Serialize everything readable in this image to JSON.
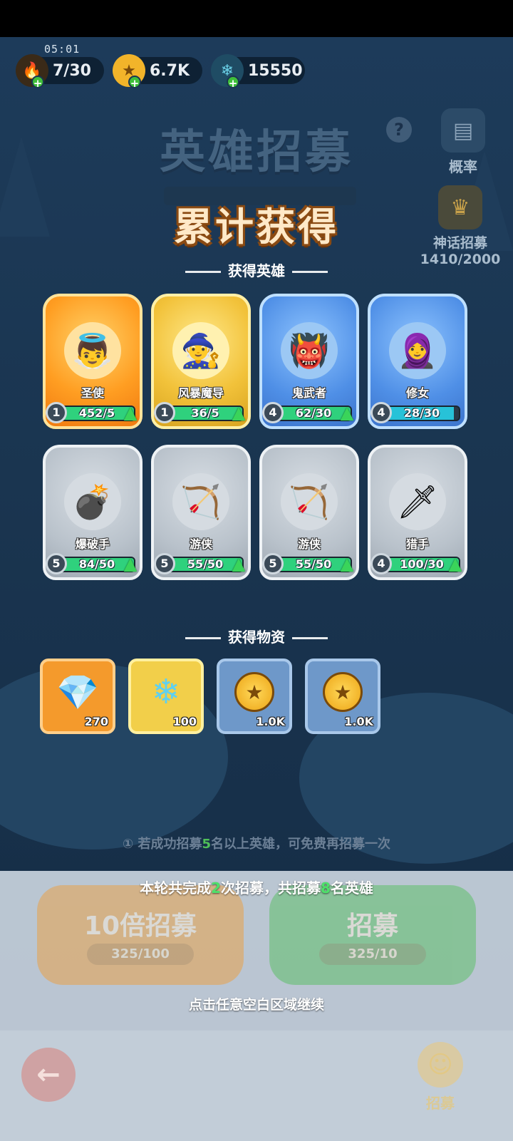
{
  "status": {
    "time": "05:01"
  },
  "resources": [
    {
      "name": "stamina",
      "value": "7/30",
      "icon": "flame-icon",
      "glyph": "🔥",
      "color": "#f39a2a"
    },
    {
      "name": "gold",
      "value": "6.7K",
      "icon": "coin-icon",
      "glyph": "★",
      "color": "#f2b42a"
    },
    {
      "name": "crystal",
      "value": "15550",
      "icon": "snowflake-icon",
      "glyph": "❄",
      "color": "#6ad0e6"
    }
  ],
  "header": {
    "bg_title": "英雄招募",
    "main_title": "累计获得",
    "help_glyph": "?"
  },
  "side": {
    "probability": {
      "label": "概率",
      "glyph": "▤"
    },
    "mythic": {
      "label": "神话招募",
      "progress": "1410/2000",
      "glyph": "♛"
    }
  },
  "heroes_section": {
    "title": "获得英雄"
  },
  "heroes": [
    {
      "name": "圣使",
      "level": "1",
      "count": "452/5",
      "fill": 1.0,
      "rarity": "orange",
      "glyph": "👼",
      "bg": "#ffe2a0",
      "up": true
    },
    {
      "name": "风暴魔导",
      "level": "1",
      "count": "36/5",
      "fill": 1.0,
      "rarity": "gold",
      "glyph": "🧙",
      "bg": "#fff1b0",
      "up": true
    },
    {
      "name": "鬼武者",
      "level": "4",
      "count": "62/30",
      "fill": 1.0,
      "rarity": "blue",
      "glyph": "👹",
      "bg": "#9cc8f4",
      "up": true
    },
    {
      "name": "修女",
      "level": "4",
      "count": "28/30",
      "fill": 0.93,
      "rarity": "blue",
      "glyph": "🧕",
      "bg": "#9cc8f4",
      "up": false
    },
    {
      "name": "爆破手",
      "level": "5",
      "count": "84/50",
      "fill": 1.0,
      "rarity": "grey",
      "glyph": "💣",
      "bg": "#d5dbe1",
      "up": true
    },
    {
      "name": "游侠",
      "level": "5",
      "count": "55/50",
      "fill": 1.0,
      "rarity": "grey",
      "glyph": "🏹",
      "bg": "#d5dbe1",
      "up": true
    },
    {
      "name": "游侠",
      "level": "5",
      "count": "55/50",
      "fill": 1.0,
      "rarity": "grey",
      "glyph": "🏹",
      "bg": "#d5dbe1",
      "up": true
    },
    {
      "name": "猎手",
      "level": "4",
      "count": "100/30",
      "fill": 1.0,
      "rarity": "grey",
      "glyph": "🗡",
      "bg": "#d5dbe1",
      "up": true
    }
  ],
  "items_section": {
    "title": "获得物资"
  },
  "items": [
    {
      "name": "orange-crystal",
      "qty": "270",
      "rarity": "orange",
      "glyph": "💎"
    },
    {
      "name": "blue-snowflake",
      "qty": "100",
      "rarity": "gold",
      "glyph": "❄"
    },
    {
      "name": "gold-coin",
      "qty": "1.0K",
      "rarity": "blue",
      "glyph": "★"
    },
    {
      "name": "gold-coin",
      "qty": "1.0K",
      "rarity": "blue",
      "glyph": "★"
    }
  ],
  "tip": {
    "prefix": "① 若成功招募",
    "num": "5",
    "suffix": "名以上英雄，可免费再招募一次"
  },
  "buttons": {
    "ten": {
      "label": "10倍招募",
      "cost": "325/100"
    },
    "one": {
      "label": "招募",
      "cost": "325/10"
    }
  },
  "summary": {
    "p1": "本轮共完成",
    "n1": "2",
    "p2": "次招募，共招募",
    "n2": "8",
    "p3": "名英雄"
  },
  "continue": "点击任意空白区域继续",
  "nav": {
    "back_glyph": "←",
    "recruit": "招募",
    "recruit_glyph": "☺"
  }
}
